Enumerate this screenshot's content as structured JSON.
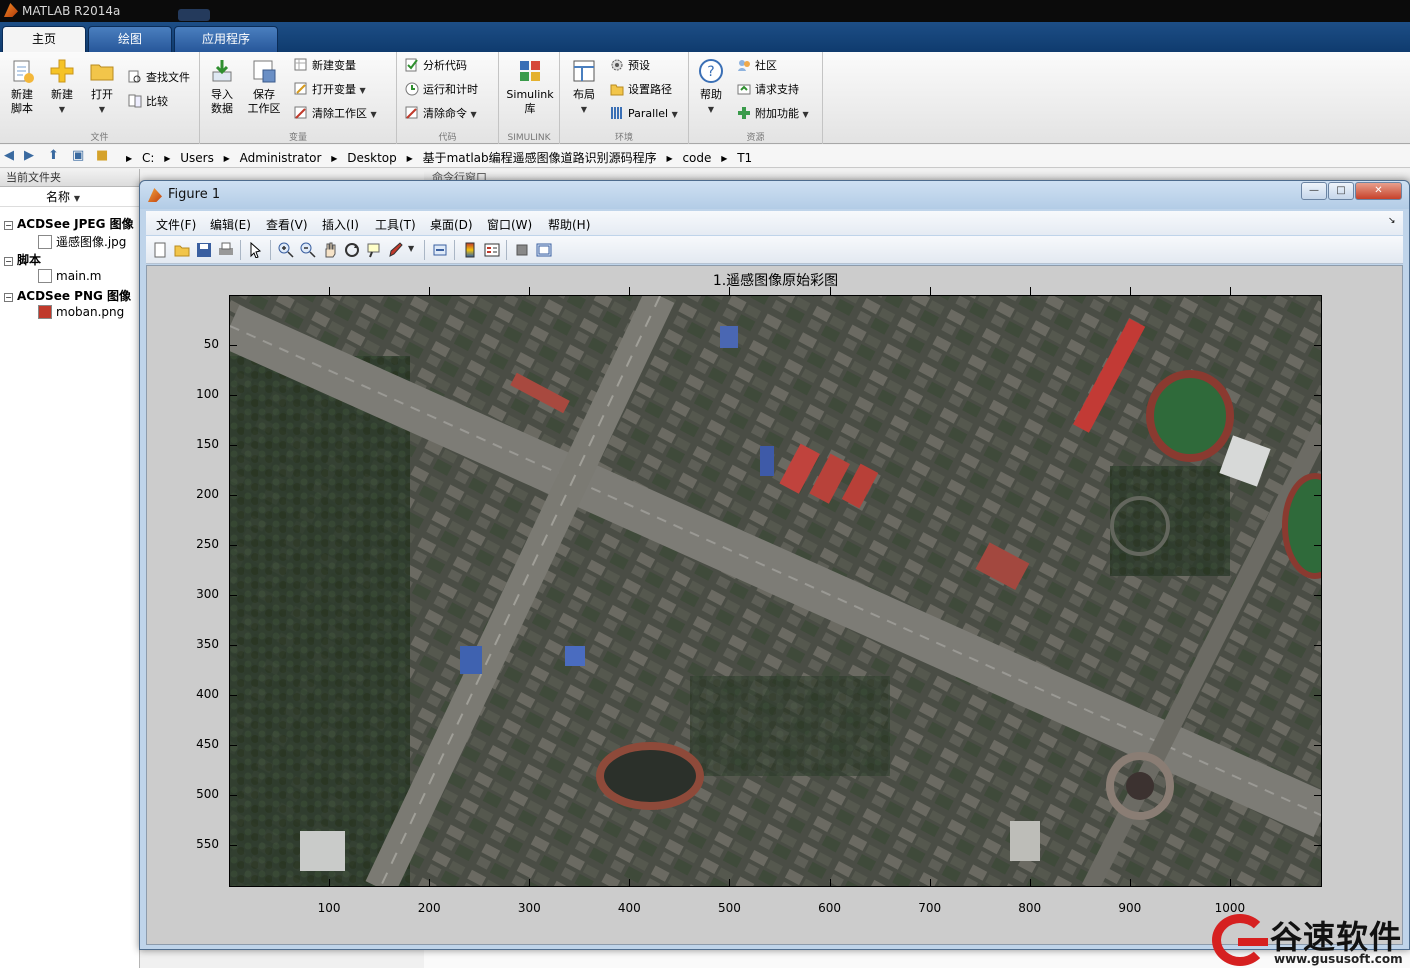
{
  "window": {
    "title": "MATLAB R2014a"
  },
  "tabs": [
    {
      "label": "主页"
    },
    {
      "label": "绘图"
    },
    {
      "label": "应用程序"
    }
  ],
  "ribbon": {
    "file": {
      "label": "文件",
      "new_script": "新建\n脚本",
      "new": "新建",
      "open": "打开",
      "find_files": "查找文件",
      "compare": "比较"
    },
    "variable": {
      "label": "变量",
      "import": "导入\n数据",
      "save_ws": "保存\n工作区",
      "new_var": "新建变量",
      "open_var": "打开变量",
      "clear_ws": "清除工作区"
    },
    "code": {
      "label": "代码",
      "analyze": "分析代码",
      "run_time": "运行和计时",
      "clear_cmd": "清除命令"
    },
    "simulink": {
      "label": "SIMULINK",
      "simulink": "Simulink\n库"
    },
    "env": {
      "label": "环境",
      "layout": "布局",
      "prefs": "预设",
      "set_path": "设置路径",
      "parallel": "Parallel"
    },
    "resources": {
      "label": "资源",
      "help": "帮助",
      "community": "社区",
      "request_support": "请求支持",
      "addons": "附加功能"
    }
  },
  "address": {
    "crumbs": [
      "C:",
      "Users",
      "Administrator",
      "Desktop",
      "基于matlab编程遥感图像道路识别源码程序",
      "code",
      "T1"
    ]
  },
  "current_folder": {
    "title": "当前文件夹",
    "name_header": "名称",
    "groups": [
      {
        "label": "ACDSee JPEG 图像",
        "items": [
          "遥感图像.jpg"
        ]
      },
      {
        "label": "脚本",
        "items": [
          "main.m"
        ]
      },
      {
        "label": "ACDSee PNG 图像",
        "items": [
          "moban.png"
        ]
      }
    ]
  },
  "command_window": {
    "title": "命令行窗口"
  },
  "figure": {
    "title": "Figure 1",
    "menu": [
      "文件(F)",
      "编辑(E)",
      "查看(V)",
      "插入(I)",
      "工具(T)",
      "桌面(D)",
      "窗口(W)",
      "帮助(H)"
    ],
    "plot_title": "1.遥感图像原始彩图",
    "y_ticks": [
      "50",
      "100",
      "150",
      "200",
      "250",
      "300",
      "350",
      "400",
      "450",
      "500",
      "550"
    ],
    "x_ticks": [
      "100",
      "200",
      "300",
      "400",
      "500",
      "600",
      "700",
      "800",
      "900",
      "1000"
    ]
  },
  "watermark": {
    "text": "谷速软件",
    "url": "www.gususoft.com"
  }
}
